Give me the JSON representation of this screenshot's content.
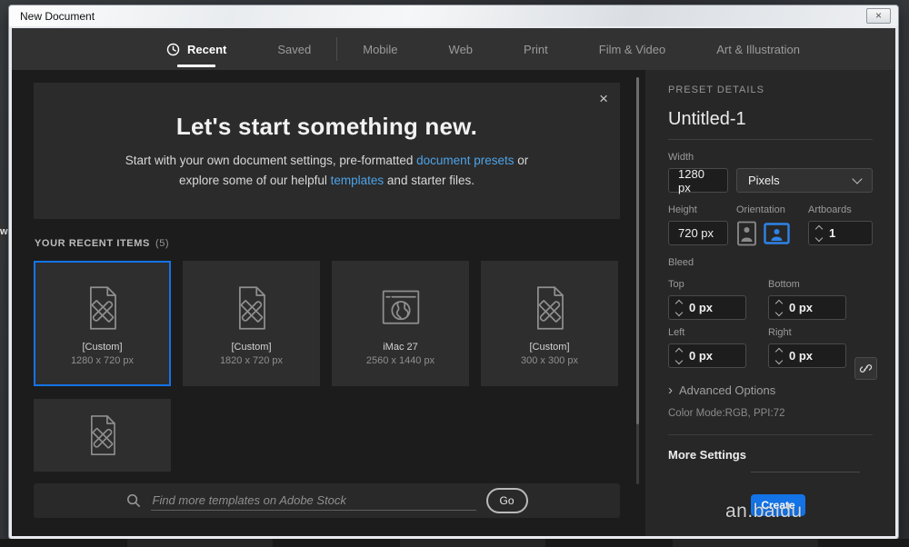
{
  "window": {
    "title": "New Document",
    "close_glyph": "×"
  },
  "tabs": [
    {
      "label": "Recent",
      "active": true
    },
    {
      "label": "Saved",
      "active": false
    },
    {
      "label": "Mobile",
      "active": false
    },
    {
      "label": "Web",
      "active": false
    },
    {
      "label": "Print",
      "active": false
    },
    {
      "label": "Film & Video",
      "active": false
    },
    {
      "label": "Art & Illustration",
      "active": false
    }
  ],
  "hero": {
    "title": "Let's start something new.",
    "body_1": "Start with your own document settings, pre-formatted ",
    "link_presets": "document presets",
    "body_2": " or explore some of our helpful ",
    "link_templates": "templates",
    "body_3": " and starter files.",
    "close_glyph": "×"
  },
  "recent": {
    "label": "YOUR RECENT ITEMS",
    "count": "(5)",
    "items": [
      {
        "name": "[Custom]",
        "size": "1280 x 720 px",
        "selected": true,
        "icon": "document-icon"
      },
      {
        "name": "[Custom]",
        "size": "1820 x 720 px",
        "selected": false,
        "icon": "document-icon"
      },
      {
        "name": "iMac 27",
        "size": "2560 x 1440 px",
        "selected": false,
        "icon": "web-browser-icon"
      },
      {
        "name": "[Custom]",
        "size": "300 x 300 px",
        "selected": false,
        "icon": "document-icon"
      }
    ]
  },
  "search": {
    "placeholder": "Find more templates on Adobe Stock",
    "go_label": "Go"
  },
  "panel": {
    "header": "PRESET DETAILS",
    "doc_name": "Untitled-1",
    "width_label": "Width",
    "width_value": "1280 px",
    "units_value": "Pixels",
    "height_label": "Height",
    "height_value": "720 px",
    "orientation_label": "Orientation",
    "artboards_label": "Artboards",
    "artboards_value": "1",
    "bleed_label": "Bleed",
    "bleed": {
      "top_label": "Top",
      "top_value": "0 px",
      "bottom_label": "Bottom",
      "bottom_value": "0 px",
      "left_label": "Left",
      "left_value": "0 px",
      "right_label": "Right",
      "right_value": "0 px"
    },
    "advanced_label": "Advanced Options",
    "advanced_chevron": "›",
    "color_mode": "Color Mode:RGB, PPI:72",
    "more_settings_label": "More Settings",
    "create_label": "Create"
  },
  "watermark": {
    "text": "an.baidu"
  },
  "background": {
    "edge_label": "w"
  },
  "colors": {
    "accent": "#1473e6",
    "link": "#4da3e8",
    "tab_active_underline": "#ffffff"
  }
}
